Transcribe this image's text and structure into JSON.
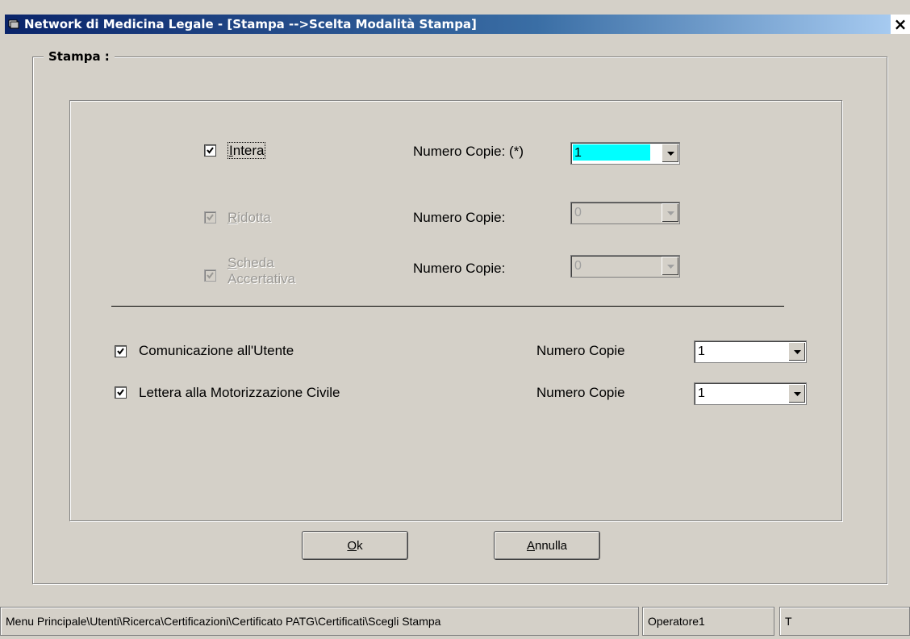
{
  "window": {
    "title": "Network di Medicina Legale - [Stampa -->Scelta Modalità Stampa]",
    "close_glyph": "×"
  },
  "group": {
    "label": "Stampa :"
  },
  "print_options": [
    {
      "label": "Intera",
      "accel": "I",
      "rest": "ntera",
      "checked": true,
      "enabled": true,
      "copies_label": "Numero Copie: (*)",
      "copies_value": "1"
    },
    {
      "label": "Ridotta",
      "accel": "R",
      "rest": "idotta",
      "checked": true,
      "enabled": false,
      "copies_label": "Numero Copie:",
      "copies_value": "0"
    },
    {
      "label": "Scheda Accertativa",
      "accel": "S",
      "rest": "cheda",
      "line2": "Accertativa",
      "checked": true,
      "enabled": false,
      "copies_label": "Numero Copie:",
      "copies_value": "0"
    }
  ],
  "documents": [
    {
      "label": "Comunicazione all'Utente",
      "checked": true,
      "copies_label": "Numero Copie",
      "copies_value": "1"
    },
    {
      "label": "Lettera alla Motorizzazione Civile",
      "checked": true,
      "copies_label": "Numero Copie",
      "copies_value": "1"
    }
  ],
  "buttons": {
    "ok": {
      "accel": "O",
      "rest": "k"
    },
    "cancel": {
      "accel": "A",
      "rest": "nnulla"
    }
  },
  "statusbar": {
    "path": "Menu Principale\\Utenti\\Ricerca\\Certificazioni\\Certificato PATG\\Certificati\\Scegli Stampa",
    "operator": "Operatore1",
    "extra": "T"
  },
  "colors": {
    "title_start": "#0a246a",
    "title_end": "#a6caf0",
    "face": "#d4d0c8",
    "highlight": "#00ffff"
  }
}
